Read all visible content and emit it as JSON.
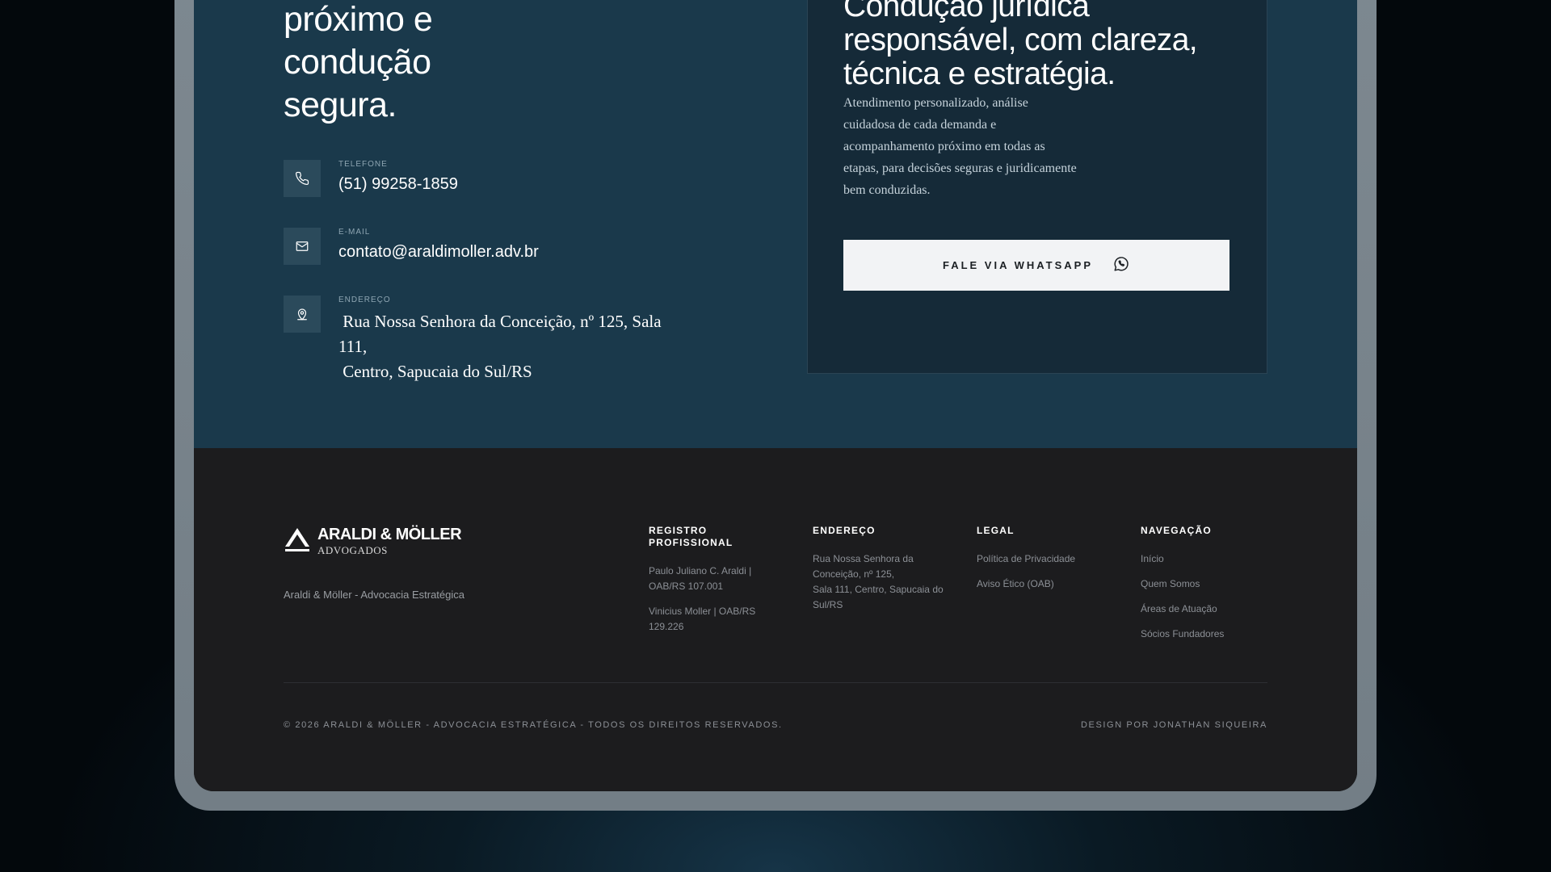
{
  "hero": {
    "title_lines": [
      "próximo e",
      "condução",
      "segura."
    ]
  },
  "contacts": {
    "phone": {
      "label": "TELEFONE",
      "value": "(51) 99258-1859",
      "icon": "phone-icon"
    },
    "email": {
      "label": "E-MAIL",
      "value": "contato@araldimoller.adv.br",
      "icon": "mail-icon"
    },
    "address": {
      "label": "ENDEREÇO",
      "line1": " Rua Nossa Senhora da Conceição, nº 125, Sala 111,",
      "line2": " Centro, Sapucaia do Sul/RS",
      "icon": "location-pin-icon"
    }
  },
  "card": {
    "title_lines": [
      "Condução jurídica",
      "responsável, com clareza,",
      "técnica e estratégia."
    ],
    "text_lines": [
      "Atendimento personalizado, análise",
      "cuidadosa de cada demanda e",
      "acompanhamento próximo em todas as",
      "etapas, para decisões seguras e juridicamente",
      "bem conduzidas."
    ],
    "button_label": "FALE VIA WHATSAPP",
    "button_icon": "whatsapp-icon"
  },
  "footer": {
    "logo": {
      "name": "ARALDI & MÖLLER",
      "sub": "ADVOGADOS"
    },
    "tagline": "Araldi & Möller - Advocacia Estratégica",
    "registro": {
      "heading_lines": [
        "REGISTRO",
        "PROFISSIONAL"
      ],
      "items": [
        [
          "Paulo Juliano C. Araldi |",
          "OAB/RS 107.001"
        ],
        [
          "Vinicius Moller | OAB/RS",
          "129.226"
        ]
      ]
    },
    "endereco": {
      "heading": "ENDEREÇO",
      "lines": [
        "Rua Nossa Senhora da",
        "Conceição, nº 125,",
        "Sala 111, Centro, Sapucaia do",
        "Sul/RS"
      ]
    },
    "legal": {
      "heading": "LEGAL",
      "links": [
        "Política de Privacidade",
        "Aviso Ético (OAB)"
      ]
    },
    "navegacao": {
      "heading": "NAVEGAÇÃO",
      "links": [
        "Início",
        "Quem Somos",
        "Áreas de Atuação",
        "Sócios Fundadores"
      ]
    },
    "copyright": "© 2026 ARALDI & MÖLLER - ADVOCACIA ESTRATÉGICA - TODOS OS DIREITOS RESERVADOS.",
    "credit": "DESIGN POR JONATHAN SIQUEIRA"
  },
  "colors": {
    "contact_bg": "#1a394b",
    "card_bg": "#152a38",
    "footer_bg": "#1c1c1e",
    "button_bg": "#f2f3f5"
  }
}
